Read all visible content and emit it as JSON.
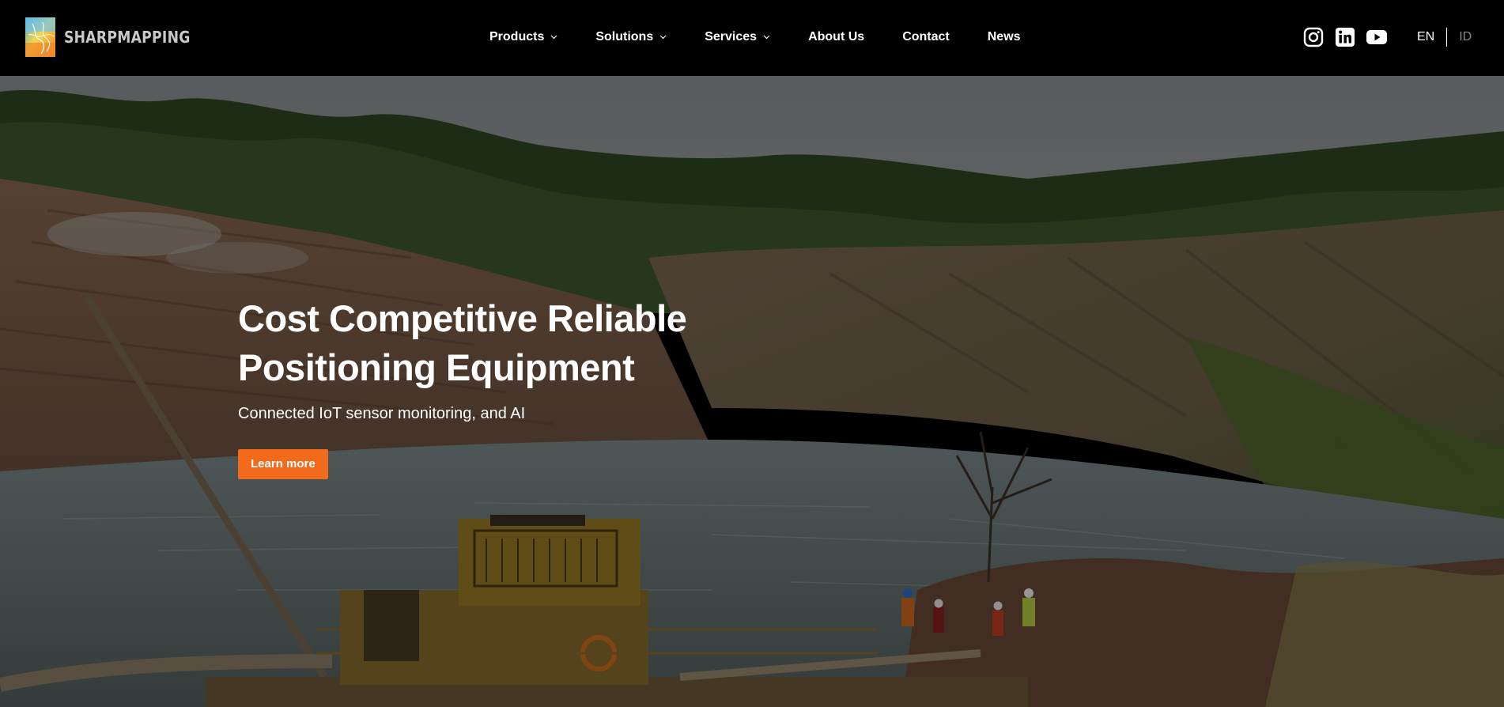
{
  "brand": {
    "name": "SHARPMAPPING",
    "logo_icon": "sharpmapping-logo"
  },
  "nav": {
    "items": [
      {
        "label": "Products",
        "has_dropdown": true
      },
      {
        "label": "Solutions",
        "has_dropdown": true
      },
      {
        "label": "Services",
        "has_dropdown": true
      },
      {
        "label": "About Us",
        "has_dropdown": false
      },
      {
        "label": "Contact",
        "has_dropdown": false
      },
      {
        "label": "News",
        "has_dropdown": false
      }
    ]
  },
  "social": [
    {
      "name": "instagram-icon"
    },
    {
      "name": "linkedin-icon"
    },
    {
      "name": "youtube-icon"
    }
  ],
  "language": {
    "options": [
      "EN",
      "ID"
    ],
    "active": "EN"
  },
  "hero": {
    "title": "Cost Competitive Reliable Positioning Equipment",
    "subtitle": "Connected IoT sensor monitoring, and AI",
    "cta_label": "Learn more",
    "background": "open-pit mine lake with dredging pontoon and workers"
  },
  "colors": {
    "header_bg": "#000000",
    "accent": "#f26b1d",
    "text": "#ffffff",
    "inactive_lang": "#8a8a8a"
  }
}
